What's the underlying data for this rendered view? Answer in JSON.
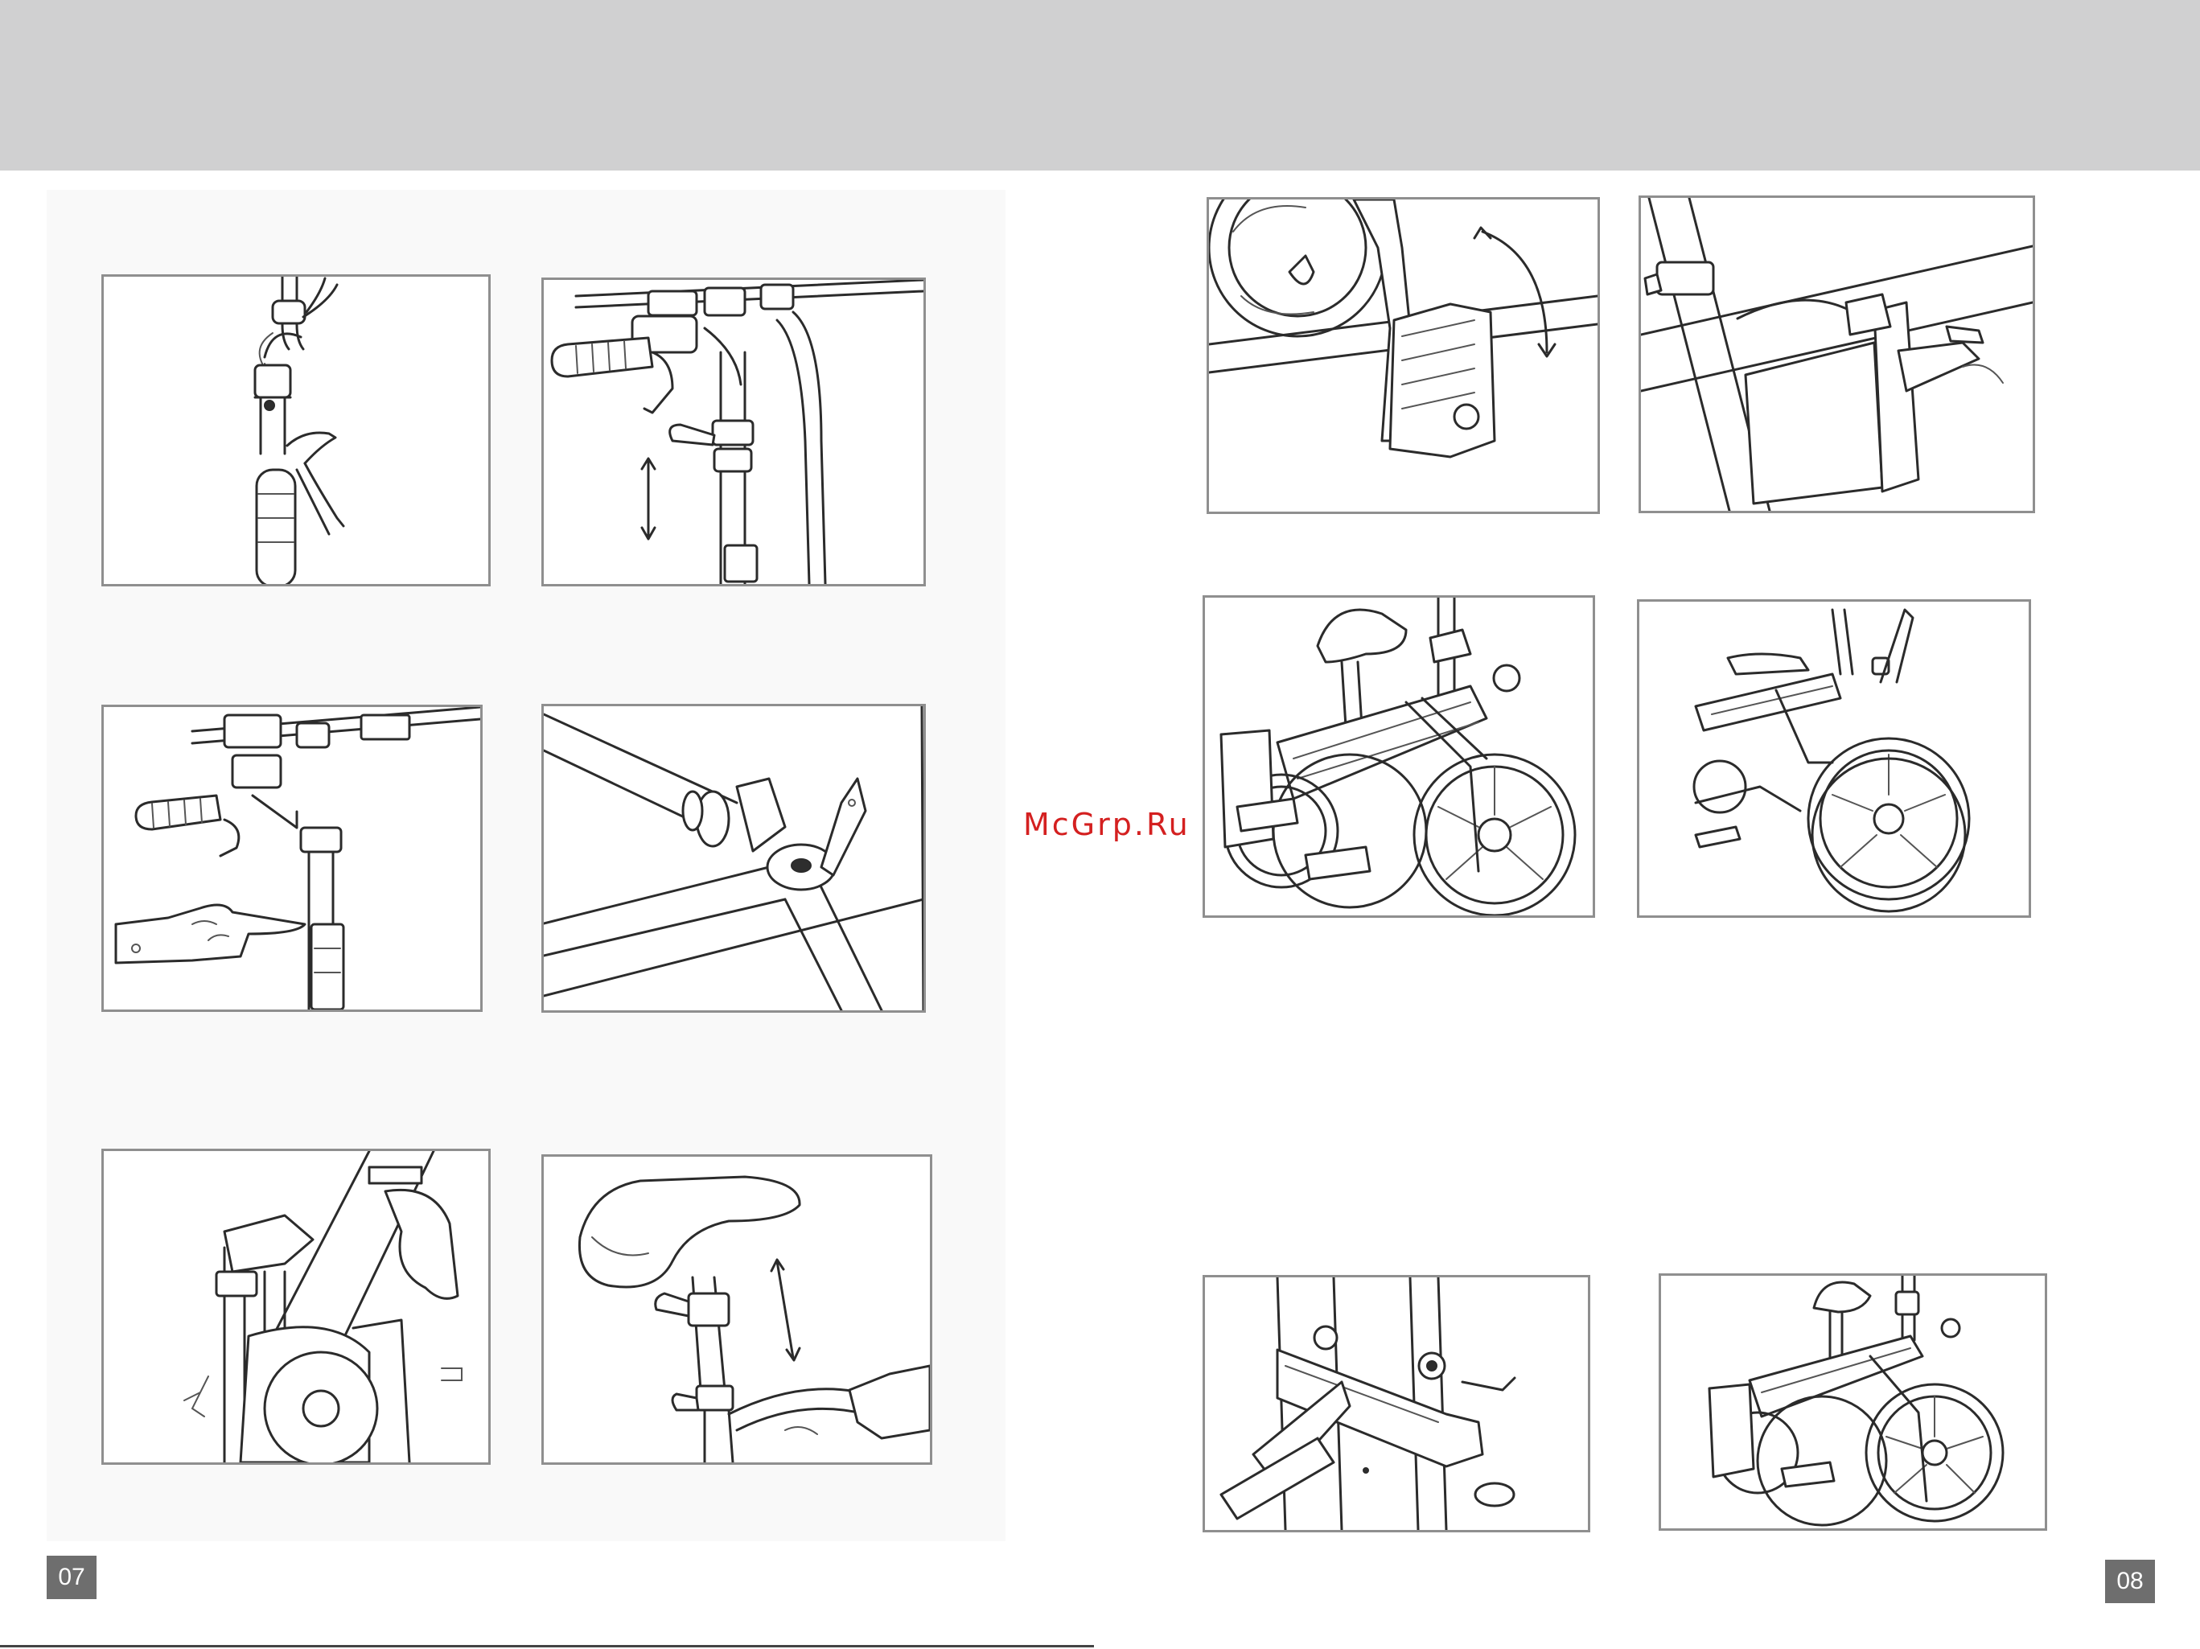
{
  "header": {
    "color": "#d0d0d1"
  },
  "watermark": {
    "text": "McGrp.Ru",
    "color": "#d42020"
  },
  "pages": {
    "left_number": "07",
    "right_number": "08"
  },
  "illustrations": {
    "left": [
      "handlebar-stem-fold-icon",
      "handlebar-height-adjust-icon",
      "handlebar-lock-press-icon",
      "frame-hinge-clamp-icon",
      "front-fork-latch-icon",
      "seat-height-adjust-icon"
    ],
    "right": [
      "pedal-fold-icon",
      "frame-fold-latch-icon",
      "folding-bike-side-icon",
      "folded-bike-icon",
      "kickstand-bracket-icon",
      "folding-bike-compact-icon"
    ]
  }
}
